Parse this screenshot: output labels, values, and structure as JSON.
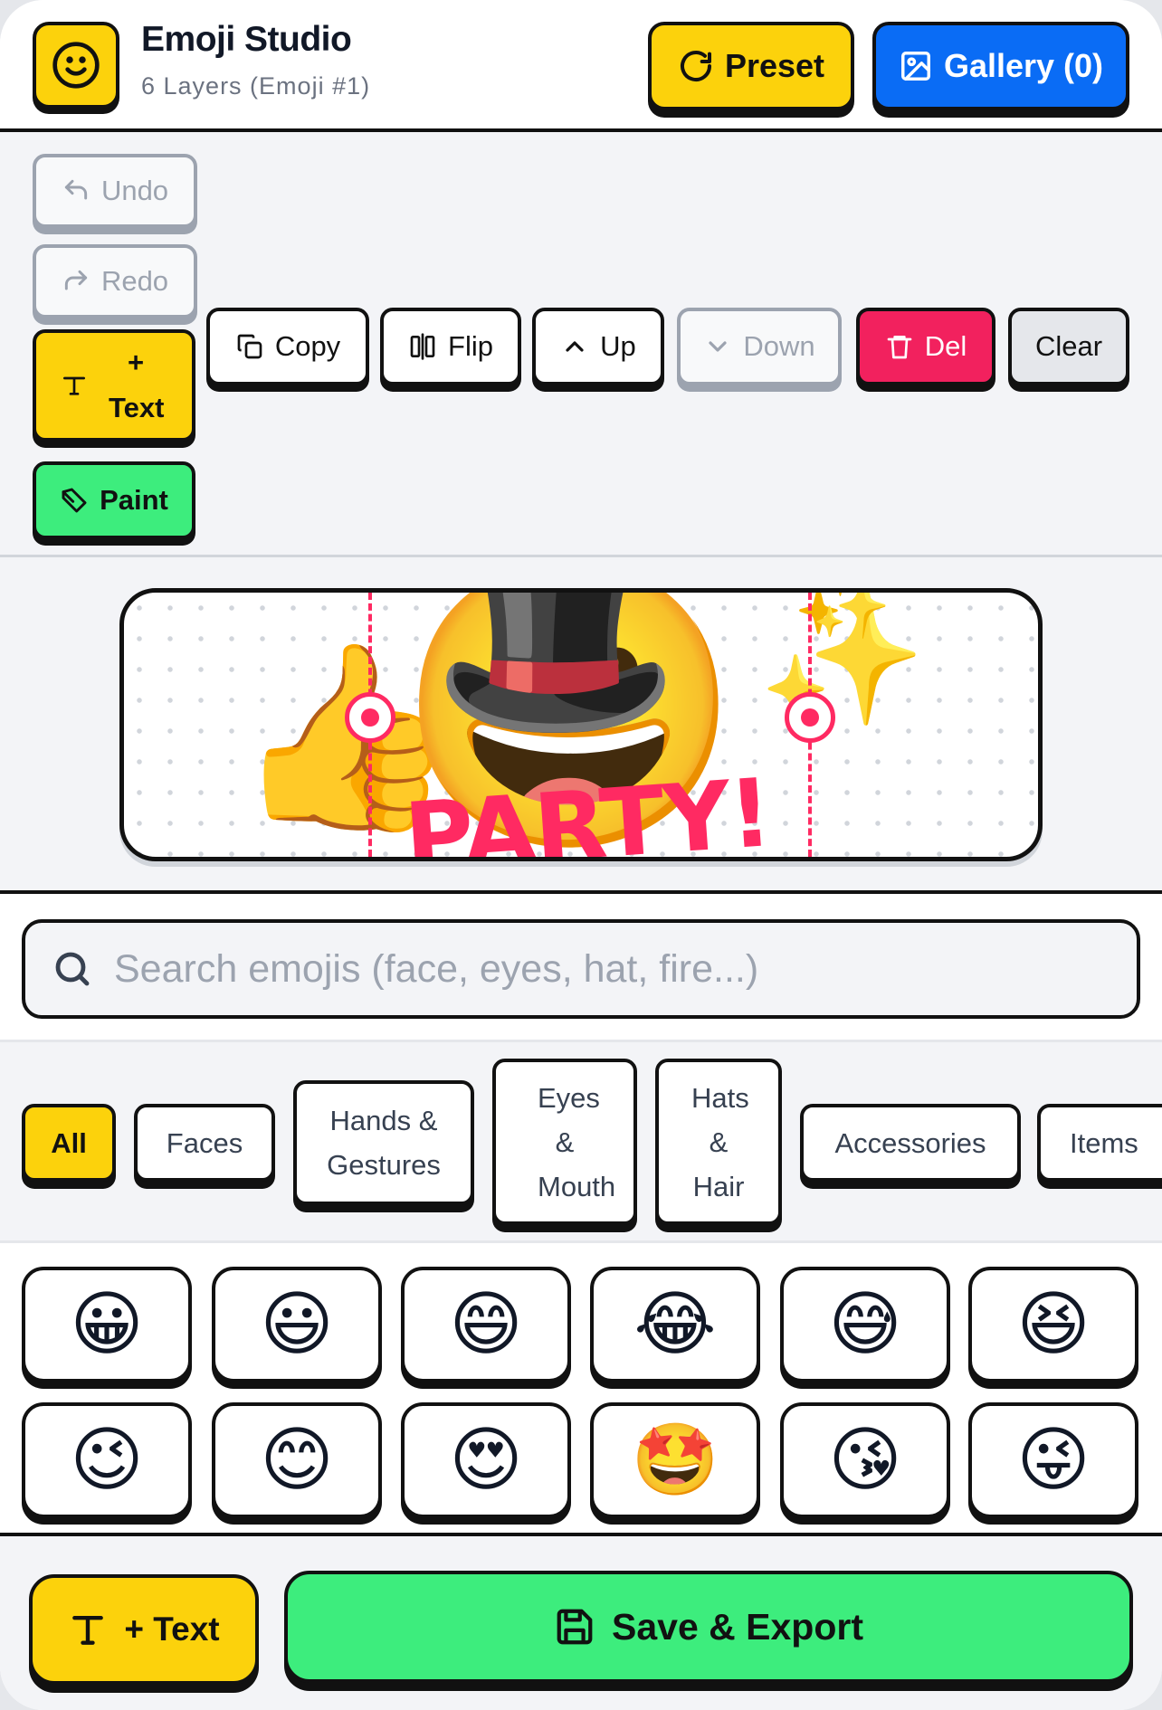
{
  "header": {
    "title": "Emoji Studio",
    "subtitle": "6 Layers (Emoji #1)",
    "preset_label": "Preset",
    "gallery_label": "Gallery (0)"
  },
  "toolbar": {
    "undo": "Undo",
    "redo": "Redo",
    "add_text": "+ Text",
    "paint": "Paint",
    "copy": "Copy",
    "flip": "Flip",
    "up": "Up",
    "down": "Down",
    "delete": "Del",
    "clear": "Clear"
  },
  "canvas": {
    "layers": [
      "👍",
      "😀",
      "🎩",
      "✨",
      "✨"
    ],
    "text_layer": "PARTY!"
  },
  "search": {
    "placeholder": "Search emojis (face, eyes, hat, fire...)"
  },
  "categories": [
    {
      "label": "All",
      "active": true
    },
    {
      "label": "Faces"
    },
    {
      "label": "Hands & Gestures"
    },
    {
      "label": "Eyes & Mouth"
    },
    {
      "label": "Hats & Hair"
    },
    {
      "label": "Accessories"
    },
    {
      "label": "Items"
    }
  ],
  "emoji_grid": [
    "😀",
    "😃",
    "😄",
    "😂",
    "😅",
    "😆",
    "😉",
    "😊",
    "😍",
    "🤩",
    "😘",
    "😜"
  ],
  "bottom": {
    "text_label": "+ Text",
    "save_label": "Save & Export"
  },
  "colors": {
    "accent_yellow": "#fcd20c",
    "accent_blue": "#0a6cf5",
    "accent_green": "#3ded7d",
    "accent_red": "#f2215e"
  },
  "icons": {
    "logo": "smiley-icon",
    "preset": "refresh-icon",
    "gallery": "image-icon",
    "search": "search-icon",
    "save": "floppy-disk-icon"
  }
}
